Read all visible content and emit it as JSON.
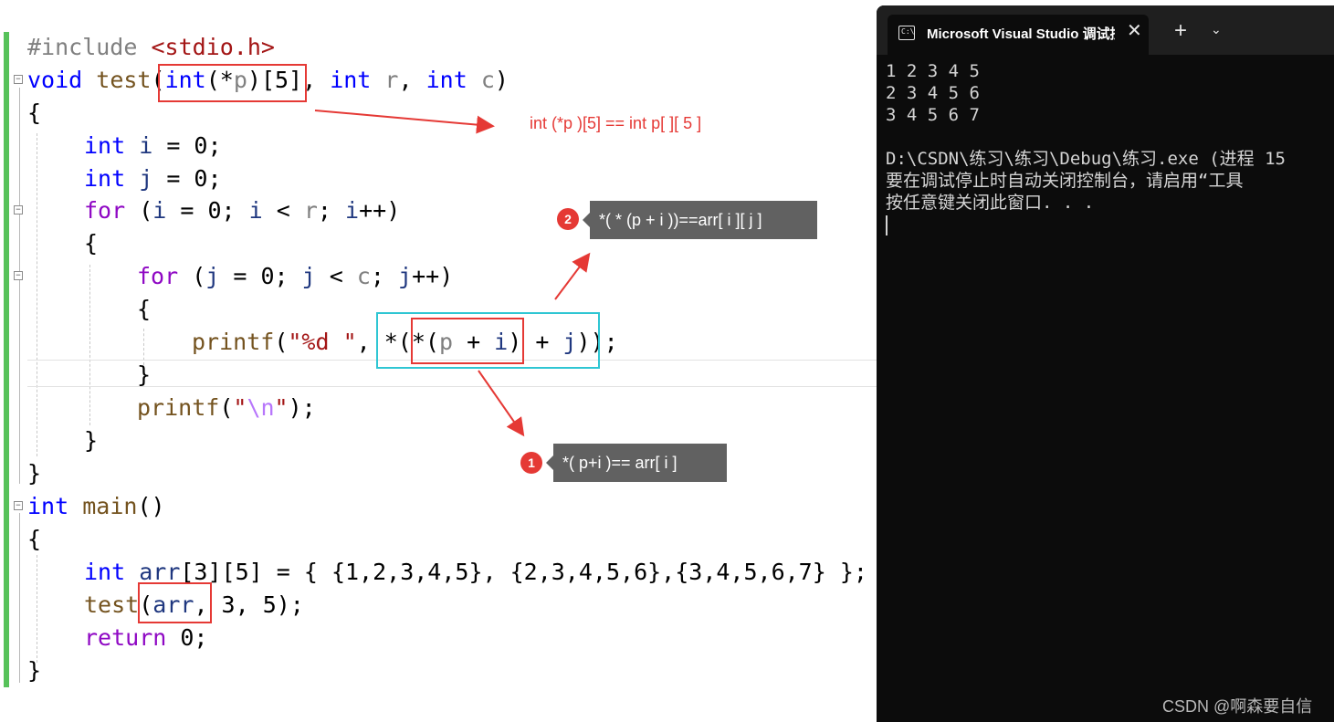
{
  "editor": {
    "code_lines": [
      "#include <stdio.h>",
      "void test(int(*p)[5], int r, int c)",
      "{",
      "int i = 0;",
      "int j = 0;",
      "for (i = 0; i < r; i++)",
      "{",
      "for (j = 0; j < c; j++)",
      "{",
      "printf(\"%d \", *(*(p + i) + j));",
      "}",
      "printf(\"\\n\");",
      "}",
      "}",
      "int main()",
      "{",
      "int arr[3][5] = { {1,2,3,4,5}, {2,3,4,5,6},{3,4,5,6,7} };",
      "test(arr, 3, 5);",
      "return 0;",
      "}"
    ],
    "fold_marker": "−"
  },
  "annotations": {
    "param_note": "int (*p )[5] == int p[ ][ 5 ]",
    "tip1_number": "1",
    "tip1_text": "*( p+i )== arr[ i ]",
    "tip2_number": "2",
    "tip2_text": "*( * (p + i ))==arr[ i ][ j ]"
  },
  "console": {
    "tab_title": "Microsoft Visual Studio 调试控制台",
    "tab_icon_text": "C:\\",
    "close_glyph": "✕",
    "new_tab_glyph": "+",
    "dropdown_glyph": "⌄",
    "output_lines": [
      "1 2 3 4 5",
      "2 3 4 5 6",
      "3 4 5 6 7",
      "",
      "D:\\CSDN\\练习\\练习\\Debug\\练习.exe (进程 15",
      "要在调试停止时自动关闭控制台，请启用“工具",
      "按任意键关闭此窗口. . ."
    ]
  },
  "watermark": "CSDN @啊森要自信",
  "colors": {
    "keyword": "#0000ff",
    "control": "#8f08c4",
    "function": "#74531f",
    "string": "#a31515",
    "annotation_red": "#e53935",
    "highlight_cyan": "#2fc6d3",
    "console_bg": "#0c0c0c"
  }
}
